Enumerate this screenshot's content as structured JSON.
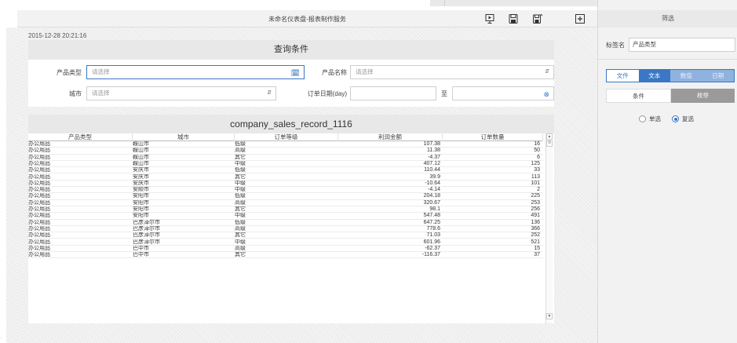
{
  "window": {
    "title": "未命名仪表盘-报表制作服务"
  },
  "timestamp": "2015-12-28 20:21:16",
  "query": {
    "title": "查询条件",
    "product_type": {
      "label": "产品类型",
      "placeholder": "请选择"
    },
    "product_name": {
      "label": "产品名称",
      "placeholder": "请选择"
    },
    "city": {
      "label": "城市",
      "placeholder": "请选择"
    },
    "order_date": {
      "label": "订单日期(day)",
      "sep": "至"
    }
  },
  "table": {
    "title": "company_sales_record_1116",
    "columns": [
      "产品类型",
      "城市",
      "订单等级",
      "利润金额",
      "订单数量"
    ],
    "rows": [
      [
        "办公用品",
        "鞍山市",
        "低级",
        "107.38",
        "16"
      ],
      [
        "办公用品",
        "鞍山市",
        "高级",
        "11.38",
        "50"
      ],
      [
        "办公用品",
        "鞍山市",
        "其它",
        "-4.37",
        "6"
      ],
      [
        "办公用品",
        "鞍山市",
        "中级",
        "407.12",
        "125"
      ],
      [
        "办公用品",
        "安庆市",
        "低级",
        "110.44",
        "33"
      ],
      [
        "办公用品",
        "安庆市",
        "其它",
        "39.9",
        "113"
      ],
      [
        "办公用品",
        "安庆市",
        "中级",
        "-10.64",
        "101"
      ],
      [
        "办公用品",
        "安顺市",
        "中级",
        "-4.14",
        "2"
      ],
      [
        "办公用品",
        "安阳市",
        "低级",
        "204.18",
        "225"
      ],
      [
        "办公用品",
        "安阳市",
        "高级",
        "320.67",
        "253"
      ],
      [
        "办公用品",
        "安阳市",
        "其它",
        "98.1",
        "256"
      ],
      [
        "办公用品",
        "安阳市",
        "中级",
        "547.48",
        "491"
      ],
      [
        "办公用品",
        "巴彦淖尔市",
        "低级",
        "647.25",
        "136"
      ],
      [
        "办公用品",
        "巴彦淖尔市",
        "高级",
        "778.6",
        "366"
      ],
      [
        "办公用品",
        "巴彦淖尔市",
        "其它",
        "71.03",
        "252"
      ],
      [
        "办公用品",
        "巴彦淖尔市",
        "中级",
        "601.96",
        "521"
      ],
      [
        "办公用品",
        "巴中市",
        "高级",
        "-62.37",
        "15"
      ],
      [
        "办公用品",
        "巴中市",
        "其它",
        "-116.37",
        "37"
      ]
    ]
  },
  "right_panel": {
    "title": "筛选",
    "tag_label": "标签名",
    "tag_value": "产品类型",
    "type_tabs": [
      "文件",
      "文本",
      "数值",
      "日期"
    ],
    "mode_tabs": [
      "条件",
      "枚举"
    ],
    "radio_single": "单选",
    "radio_multi": "复选"
  },
  "colors": {
    "accent": "#3a77c4"
  }
}
